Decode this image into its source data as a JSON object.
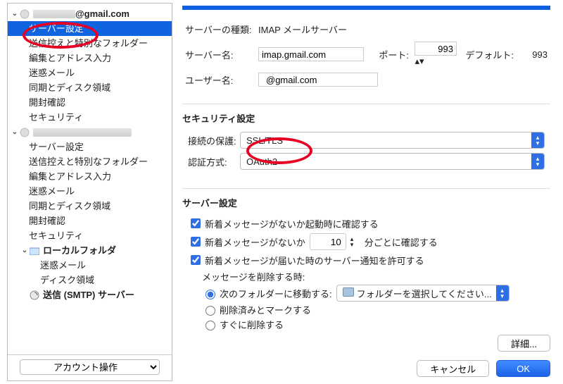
{
  "sidebar": {
    "accounts": [
      {
        "label": "@gmail.com",
        "has_obscured_name": true,
        "expanded": true,
        "icon": "account-icon",
        "children": [
          {
            "label": "サーバー設定",
            "selected": true
          },
          {
            "label": "送信控えと特別なフォルダー"
          },
          {
            "label": "編集とアドレス入力"
          },
          {
            "label": "迷惑メール"
          },
          {
            "label": "同期とディスク領域"
          },
          {
            "label": "開封確認"
          },
          {
            "label": "セキュリティ"
          }
        ]
      },
      {
        "label": "",
        "has_obscured_name": true,
        "expanded": true,
        "icon": "account-icon",
        "children": [
          {
            "label": "サーバー設定"
          },
          {
            "label": "送信控えと特別なフォルダー"
          },
          {
            "label": "編集とアドレス入力"
          },
          {
            "label": "迷惑メール"
          },
          {
            "label": "同期とディスク領域"
          },
          {
            "label": "開封確認"
          },
          {
            "label": "セキュリティ"
          }
        ]
      },
      {
        "label": "ローカルフォルダ",
        "expanded": true,
        "icon": "local-folders-icon",
        "children": [
          {
            "label": "迷惑メール"
          },
          {
            "label": "ディスク領域"
          }
        ]
      },
      {
        "label": "送信 (SMTP) サーバー",
        "icon": "smtp-icon",
        "bold": true
      }
    ],
    "account_actions_label": "アカウント操作"
  },
  "main": {
    "server_type": {
      "label": "サーバーの種類:",
      "value": "IMAP メールサーバー"
    },
    "server_name": {
      "label": "サーバー名:",
      "value": "imap.gmail.com"
    },
    "port": {
      "label": "ポート:",
      "value": "993"
    },
    "default_port": {
      "label": "デフォルト:",
      "value": "993"
    },
    "user_name": {
      "label": "ユーザー名:",
      "value": "@gmail.com",
      "has_obscured_name": true
    },
    "security": {
      "title": "セキュリティ設定",
      "connection_protection": {
        "label": "接続の保護:",
        "value": "SSL/TLS"
      },
      "auth_method": {
        "label": "認証方式:",
        "value": "OAuth2"
      }
    },
    "server_settings": {
      "title": "サーバー設定",
      "check_on_startup": {
        "checked": true,
        "label": "新着メッセージがないか起動時に確認する"
      },
      "check_every": {
        "checked": true,
        "label_before": "新着メッセージがないか",
        "value": "10",
        "label_after": "分ごとに確認する"
      },
      "allow_push": {
        "checked": true,
        "label": "新着メッセージが届いた時のサーバー通知を許可する"
      },
      "when_delete_label": "メッセージを削除する時:",
      "delete_options": {
        "selected": "move",
        "move": {
          "label": "次のフォルダーに移動する:",
          "folder_placeholder": "フォルダーを選択してください..."
        },
        "mark": {
          "label": "削除済みとマークする"
        },
        "remove": {
          "label": "すぐに削除する"
        }
      }
    },
    "buttons": {
      "detail": "詳細...",
      "cancel": "キャンセル",
      "ok": "OK"
    }
  }
}
